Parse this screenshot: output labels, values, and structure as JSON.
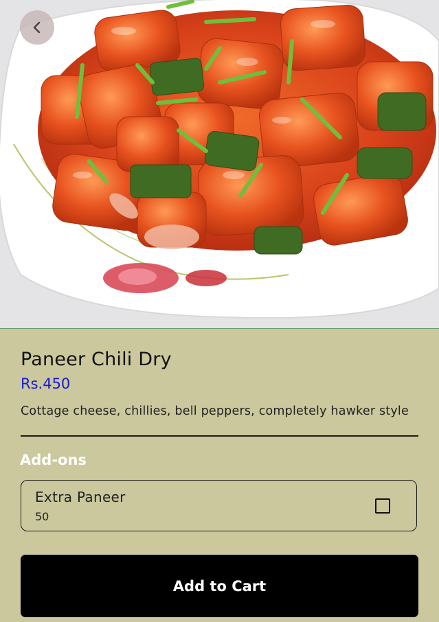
{
  "header": {
    "back_icon": "chevron-left-icon",
    "image_description": "Paneer chili dry on white plate"
  },
  "item": {
    "title": "Paneer Chili Dry",
    "price": "Rs.450",
    "description": "Cottage cheese, chillies, bell peppers, completely hawker style"
  },
  "addons": {
    "heading": "Add-ons",
    "items": [
      {
        "name": "Extra Paneer",
        "price": "50",
        "checked": false
      }
    ]
  },
  "actions": {
    "add_to_cart_label": "Add to Cart"
  },
  "colors": {
    "background": "#cac89c",
    "price": "#1a1ad6",
    "button": "#000000",
    "button_text": "#ffffff"
  }
}
